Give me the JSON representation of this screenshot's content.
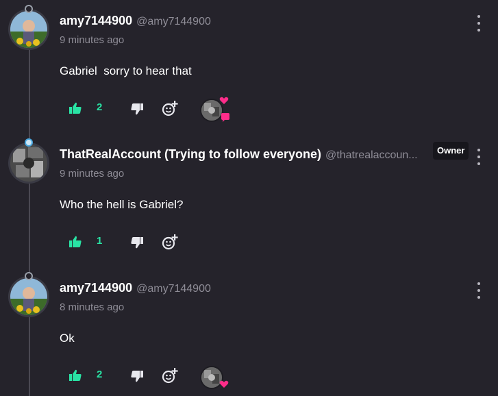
{
  "colors": {
    "background": "#25232b",
    "like_green": "#29e3a4",
    "heart_pink": "#ff2d8a",
    "muted_text": "#8f8d97"
  },
  "comments": [
    {
      "username": "amy7144900",
      "handle": "@amy7144900",
      "timestamp": "9 minutes ago",
      "text": "Gabriel  sorry to hear that",
      "likes": "2",
      "owner_badge": null,
      "creator_heart": true,
      "icons": [
        "thumbs-up-icon",
        "thumbs-down-icon",
        "add-reaction-icon",
        "more-vertical-icon"
      ]
    },
    {
      "username": "ThatRealAccount (Trying to follow everyone)",
      "handle": "@thatrealaccoun...",
      "timestamp": "9 minutes ago",
      "text": "Who the hell is Gabriel?",
      "likes": "1",
      "owner_badge": "Owner",
      "creator_heart": false,
      "icons": [
        "thumbs-up-icon",
        "thumbs-down-icon",
        "add-reaction-icon",
        "more-vertical-icon"
      ]
    },
    {
      "username": "amy7144900",
      "handle": "@amy7144900",
      "timestamp": "8 minutes ago",
      "text": "Ok",
      "likes": "2",
      "owner_badge": null,
      "creator_heart": true,
      "icons": [
        "thumbs-up-icon",
        "thumbs-down-icon",
        "add-reaction-icon",
        "more-vertical-icon"
      ]
    }
  ]
}
